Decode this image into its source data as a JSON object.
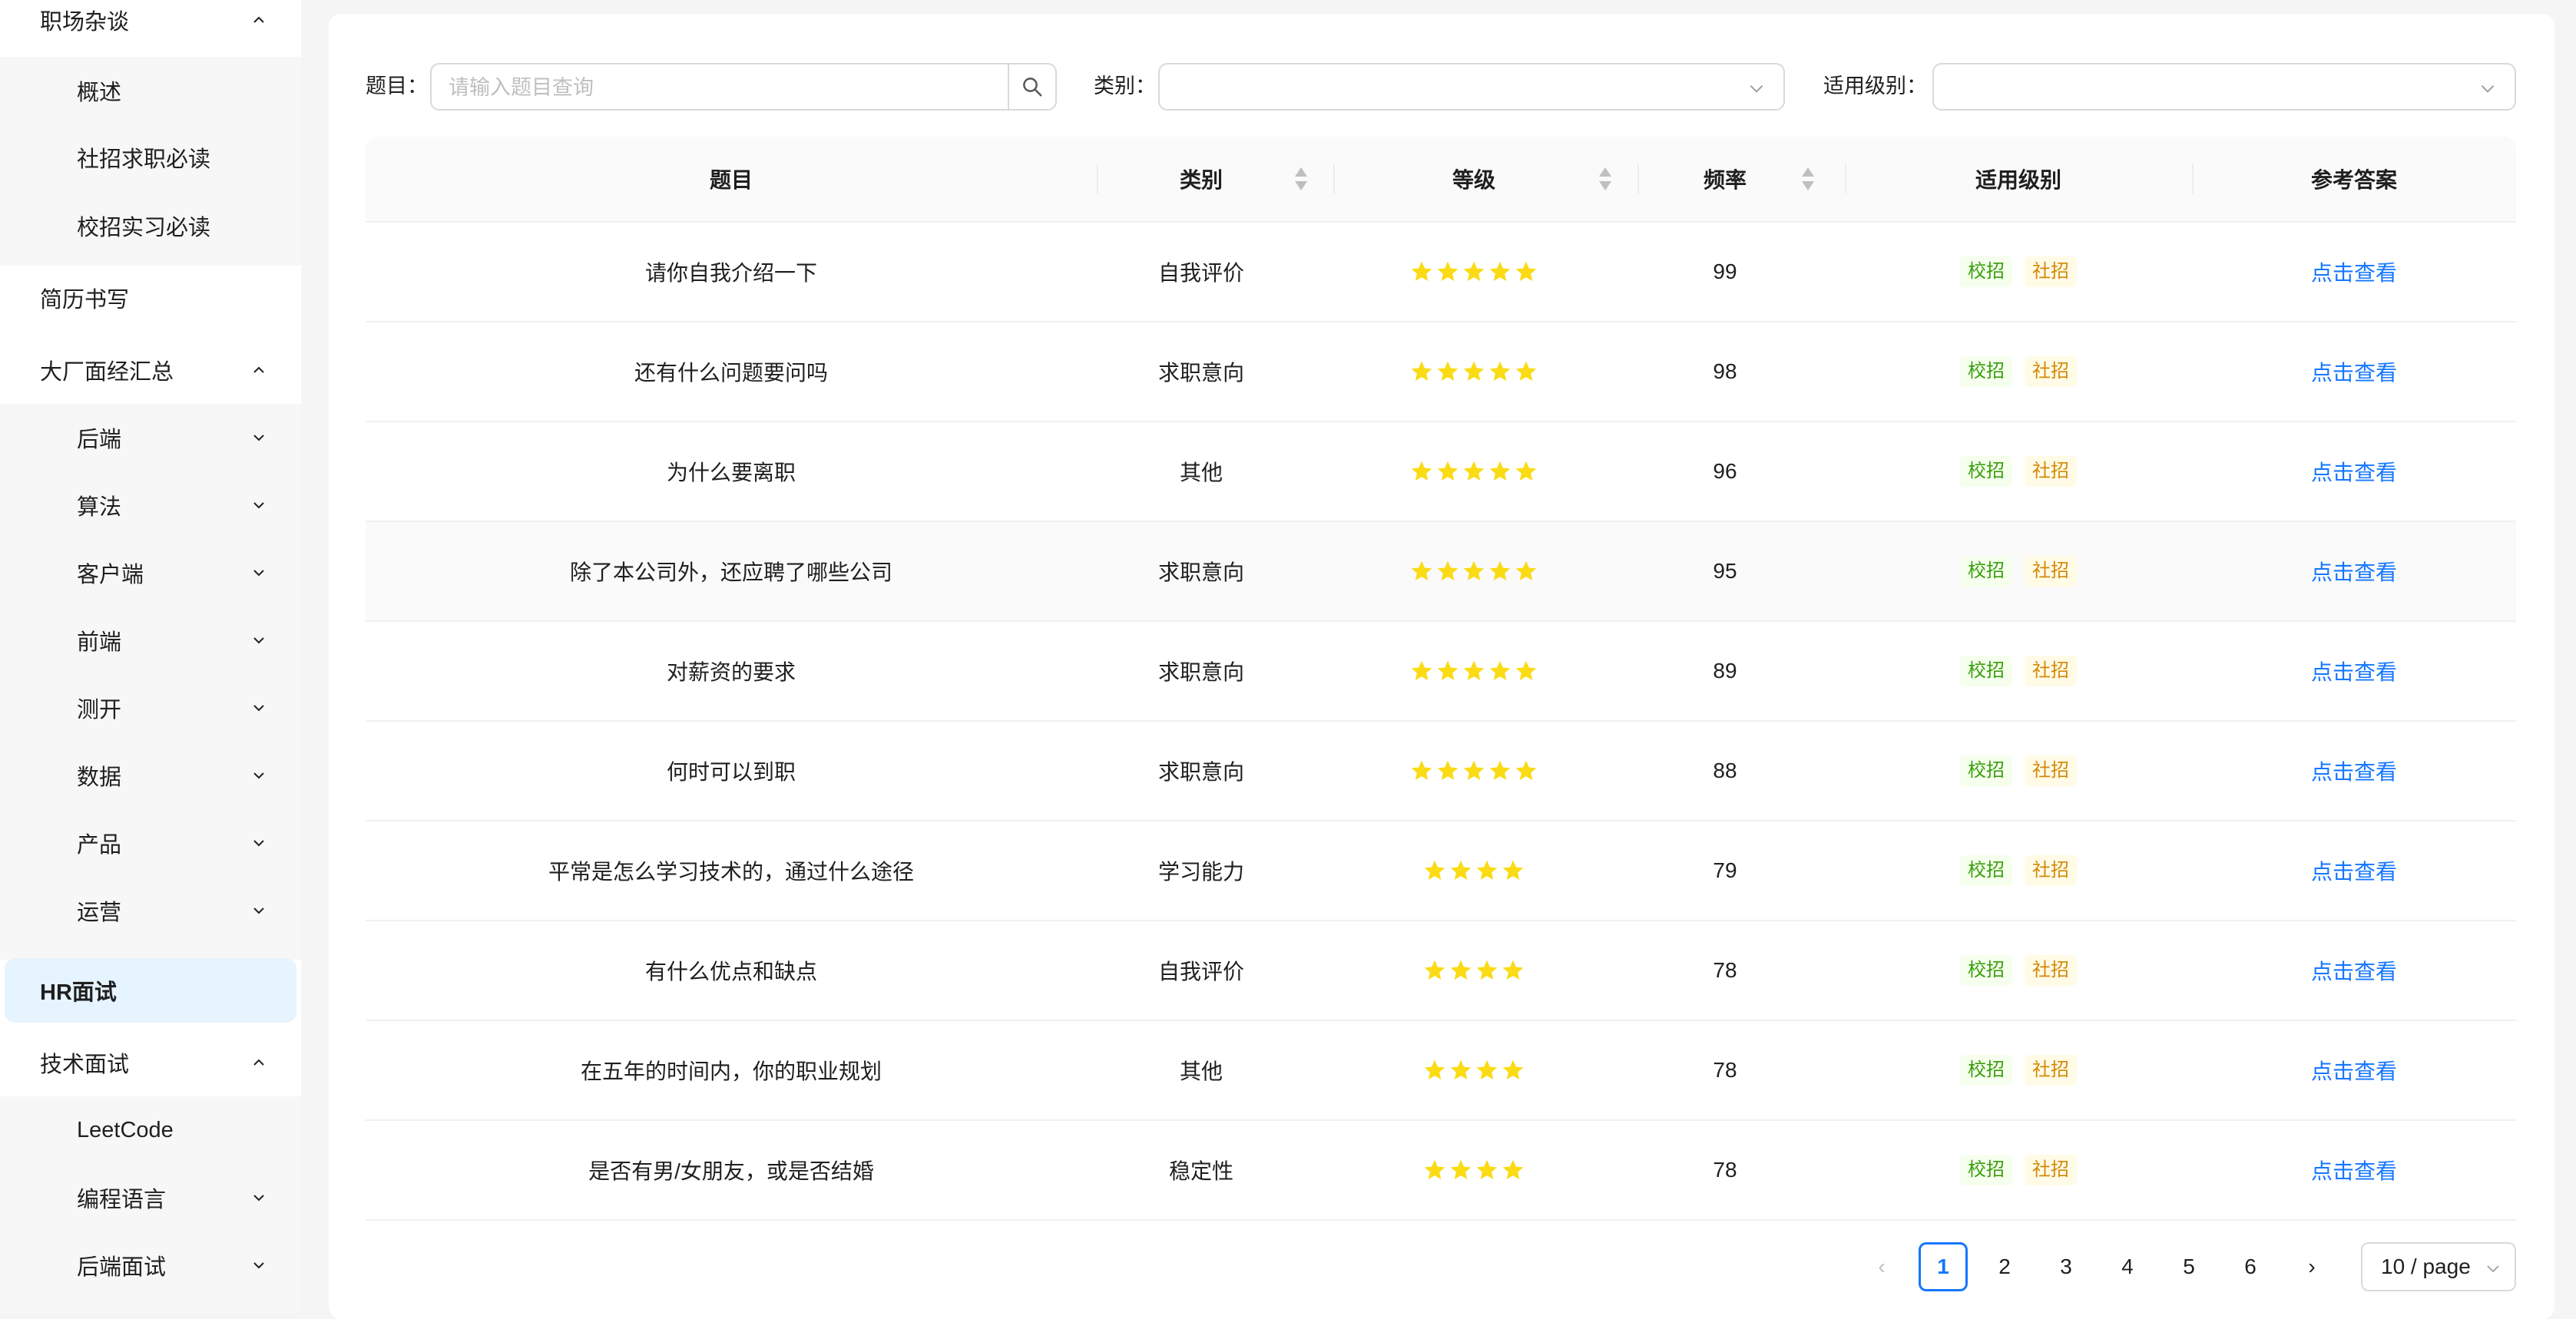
{
  "sidebar": {
    "items": [
      {
        "label": "职场杂谈",
        "level": "top",
        "expanded": true
      },
      {
        "label": "概述",
        "level": "sub"
      },
      {
        "label": "社招求职必读",
        "level": "sub"
      },
      {
        "label": "校招实习必读",
        "level": "sub"
      },
      {
        "label": "简历书写",
        "level": "top"
      },
      {
        "label": "大厂面经汇总",
        "level": "top",
        "expanded": true
      },
      {
        "label": "后端",
        "level": "sub",
        "collapsed": true
      },
      {
        "label": "算法",
        "level": "sub",
        "collapsed": true
      },
      {
        "label": "客户端",
        "level": "sub",
        "collapsed": true
      },
      {
        "label": "前端",
        "level": "sub",
        "collapsed": true
      },
      {
        "label": "测开",
        "level": "sub",
        "collapsed": true
      },
      {
        "label": "数据",
        "level": "sub",
        "collapsed": true
      },
      {
        "label": "产品",
        "level": "sub",
        "collapsed": true
      },
      {
        "label": "运营",
        "level": "sub",
        "collapsed": true
      },
      {
        "label": "HR面试",
        "level": "top",
        "active": true
      },
      {
        "label": "技术面试",
        "level": "top",
        "expanded": true
      },
      {
        "label": "LeetCode",
        "level": "sub"
      },
      {
        "label": "编程语言",
        "level": "sub",
        "collapsed": true
      },
      {
        "label": "后端面试",
        "level": "sub",
        "collapsed": true
      }
    ]
  },
  "filters": {
    "question_label": "题目：",
    "question_placeholder": "请输入题目查询",
    "question_value": "",
    "category_label": "类别：",
    "category_value": "",
    "level_label": "适用级别：",
    "level_value": ""
  },
  "table": {
    "headers": [
      "题目",
      "类别",
      "等级",
      "频率",
      "适用级别",
      "参考答案"
    ],
    "rows": [
      {
        "question": "请你自我介绍一下",
        "category": "自我评价",
        "stars": 5,
        "frequency": "99",
        "tags": [
          "校招",
          "社招"
        ],
        "answer": "点击查看"
      },
      {
        "question": "还有什么问题要问吗",
        "category": "求职意向",
        "stars": 5,
        "frequency": "98",
        "tags": [
          "校招",
          "社招"
        ],
        "answer": "点击查看"
      },
      {
        "question": "为什么要离职",
        "category": "其他",
        "stars": 5,
        "frequency": "96",
        "tags": [
          "校招",
          "社招"
        ],
        "answer": "点击查看"
      },
      {
        "question": "除了本公司外，还应聘了哪些公司",
        "category": "求职意向",
        "stars": 5,
        "frequency": "95",
        "tags": [
          "校招",
          "社招"
        ],
        "answer": "点击查看"
      },
      {
        "question": "对薪资的要求",
        "category": "求职意向",
        "stars": 5,
        "frequency": "89",
        "tags": [
          "校招",
          "社招"
        ],
        "answer": "点击查看"
      },
      {
        "question": "何时可以到职",
        "category": "求职意向",
        "stars": 5,
        "frequency": "88",
        "tags": [
          "校招",
          "社招"
        ],
        "answer": "点击查看"
      },
      {
        "question": "平常是怎么学习技术的，通过什么途径",
        "category": "学习能力",
        "stars": 4,
        "frequency": "79",
        "tags": [
          "校招",
          "社招"
        ],
        "answer": "点击查看"
      },
      {
        "question": "有什么优点和缺点",
        "category": "自我评价",
        "stars": 4,
        "frequency": "78",
        "tags": [
          "校招",
          "社招"
        ],
        "answer": "点击查看"
      },
      {
        "question": "在五年的时间内，你的职业规划",
        "category": "其他",
        "stars": 4,
        "frequency": "78",
        "tags": [
          "校招",
          "社招"
        ],
        "answer": "点击查看"
      },
      {
        "question": "是否有男/女朋友，或是否结婚",
        "category": "稳定性",
        "stars": 4,
        "frequency": "78",
        "tags": [
          "校招",
          "社招"
        ],
        "answer": "点击查看"
      }
    ]
  },
  "pagination": {
    "prev": "‹",
    "pages": [
      "1",
      "2",
      "3",
      "4",
      "5",
      "6"
    ],
    "current": "1",
    "next": "›",
    "page_size": "10 / page"
  },
  "colors": {
    "accent": "#1677ff",
    "star": "#fadb14",
    "tag_campus": "#389e0d",
    "tag_social": "#d48806",
    "active_menu_bg": "#e6f4ff"
  },
  "icons": {
    "search": "search-icon",
    "chevron_up": "chevron-up-icon",
    "chevron_down": "chevron-down-icon",
    "sort": "sort-icon",
    "star": "star-icon"
  }
}
